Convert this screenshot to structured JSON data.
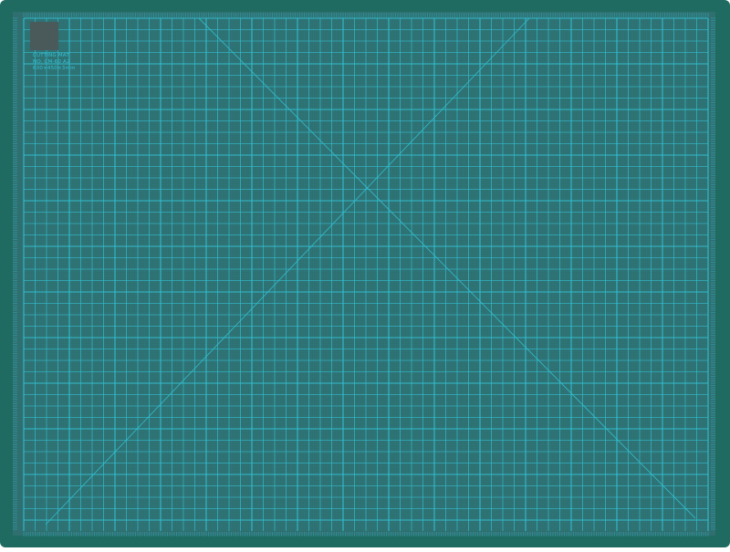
{
  "mat": {
    "colors": {
      "border": "#1f6b62",
      "surface": "#2f6f70",
      "grid_line": "#33c2d4",
      "logo_square": "#4a5a5b"
    },
    "label_lines": [
      "CUTTING MAT",
      "NO. CM-60 A2",
      "600×450×3mm"
    ]
  }
}
